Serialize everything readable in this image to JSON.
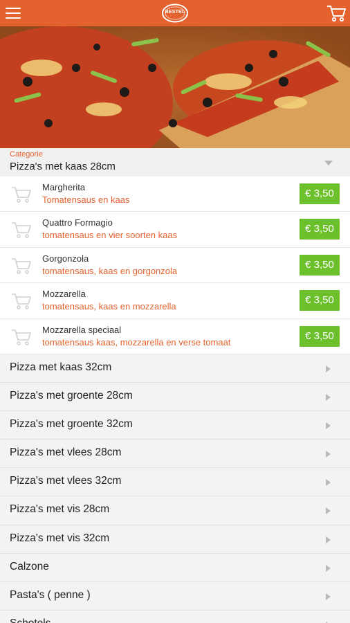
{
  "header": {
    "menu_icon": "hamburger-menu-icon",
    "logo_text": "BESTEL",
    "cart_icon": "shopping-cart-icon",
    "bar_color": "#e4622e"
  },
  "hero": {
    "image": "pizza-photo"
  },
  "selected_category": {
    "label": "Categorie",
    "name": "Pizza's met kaas 28cm"
  },
  "products": [
    {
      "name": "Margherita",
      "description": "Tomatensaus en kaas",
      "price": "€ 3,50"
    },
    {
      "name": "Quattro Formagio",
      "description": "tomatensaus en vier soorten kaas",
      "price": "€ 3,50"
    },
    {
      "name": "Gorgonzola",
      "description": "tomatensaus, kaas en gorgonzola",
      "price": "€ 3,50"
    },
    {
      "name": "Mozzarella",
      "description": "tomatensaus, kaas en mozzarella",
      "price": "€ 3,50"
    },
    {
      "name": "Mozzarella speciaal",
      "description": "tomatensaus kaas, mozzarella en verse tomaat",
      "price": "€ 3,50"
    }
  ],
  "categories": [
    "Pizza met kaas 32cm",
    "Pizza's met groente 28cm",
    "Pizza's met groente 32cm",
    "Pizza's met vlees 28cm",
    "Pizza's met vlees 32cm",
    "Pizza's met vis 28cm",
    "Pizza's met vis 32cm",
    "Calzone",
    "Pasta's ( penne )",
    "Schotels"
  ],
  "colors": {
    "accent": "#e4622e",
    "price": "#6cc02c"
  }
}
